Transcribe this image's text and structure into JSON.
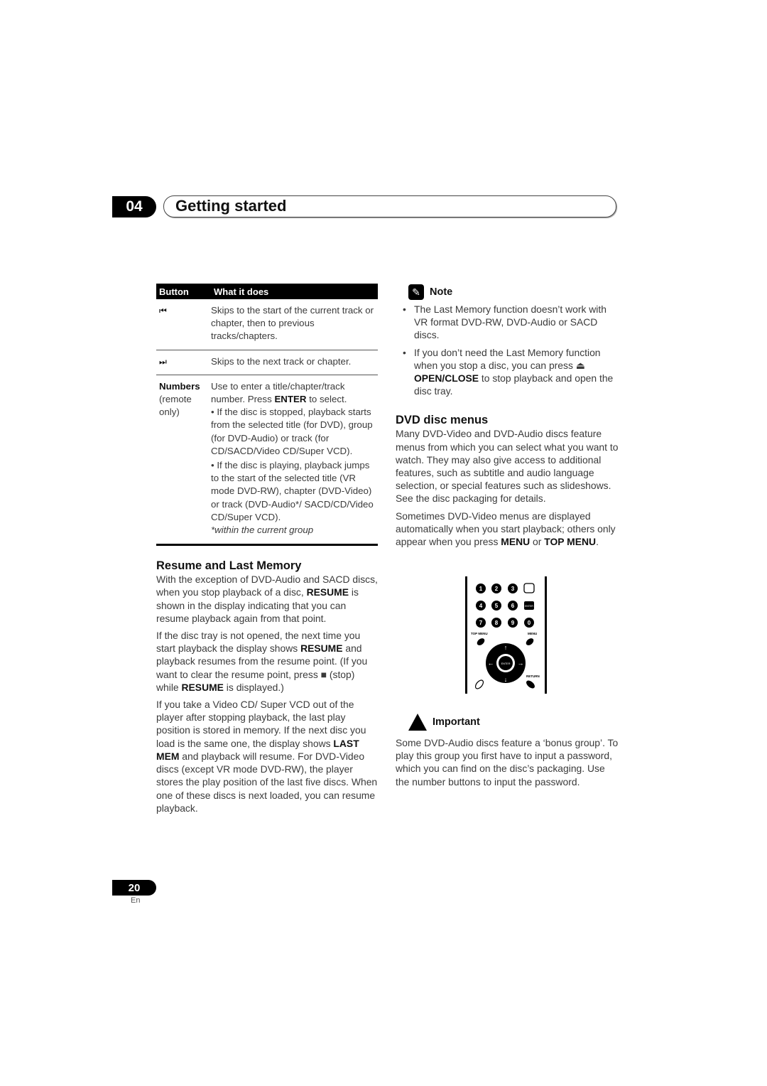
{
  "header": {
    "chapter_number": "04",
    "chapter_title": "Getting started"
  },
  "table": {
    "headers": [
      "Button",
      "What it does"
    ],
    "rows": [
      {
        "button_icon": "skip-previous-icon",
        "button_glyph": "⏮",
        "description": "Skips to the start of the current track or chapter, then to previous tracks/chapters."
      },
      {
        "button_icon": "skip-next-icon",
        "button_glyph": "⏭",
        "description": "Skips to the next track or chapter."
      },
      {
        "button_label": "Numbers",
        "button_sublabel": "(remote only)",
        "description_pre": "Use to enter a title/chapter/track number. Press ",
        "description_bold": "ENTER",
        "description_post": " to select.",
        "bullet1": "• If the disc is stopped, playback starts from the selected title (for DVD), group (for DVD-Audio) or track (for CD/SACD/Video CD/Super VCD).",
        "bullet2": "• If the disc is playing, playback jumps to the start of the selected title (VR mode DVD-RW), chapter (DVD-Video) or track (DVD-Audio*/ SACD/CD/Video CD/Super VCD).",
        "footnote": "*within the current group"
      }
    ]
  },
  "resume": {
    "heading": "Resume and Last Memory",
    "p1_a": "With the exception of DVD-Audio and SACD discs, when you stop playback of a disc, ",
    "p1_b": "RESUME",
    "p1_c": " is shown in the display indicating that you can resume playback again from that point.",
    "p2_a": "If the disc tray is not opened, the next time you start playback the display shows ",
    "p2_b": "RESUME",
    "p2_c": " and playback resumes from the resume point. (If you want to clear the resume point, press ■ (stop) while ",
    "p2_d": "RESUME",
    "p2_e": " is displayed.)",
    "p3_a": "If you take a Video CD/ Super VCD out of the player after stopping playback, the last play position is stored in memory. If the next disc you load is the same one, the display shows ",
    "p3_b": "LAST MEM",
    "p3_c": " and playback will resume. For DVD-Video discs (except VR mode DVD-RW), the player stores the play position of the last five discs. When one of these discs is next loaded, you can resume playback."
  },
  "note": {
    "label": "Note",
    "item1": "The Last Memory function doesn’t work with VR format DVD-RW, DVD-Audio or SACD discs.",
    "item2_a": "If you don’t need the Last Memory function when you stop a disc, you can press ⏏ ",
    "item2_b": "OPEN/CLOSE",
    "item2_c": " to stop playback and open the disc tray."
  },
  "dvd_menus": {
    "heading": "DVD disc menus",
    "p1": "Many DVD-Video and DVD-Audio discs feature menus from which you can select what you want to watch. They may also give access to additional features, such as subtitle and audio language selection, or special features such as slideshows. See the disc packaging for details.",
    "p2_a": "Sometimes DVD-Video menus are displayed automatically when you start playback; others only appear when you press ",
    "p2_b": "MENU",
    "p2_c": " or ",
    "p2_d": "TOP MENU",
    "p2_e": "."
  },
  "remote": {
    "number_keys": [
      "1",
      "2",
      "3",
      "4",
      "5",
      "6",
      "7",
      "8",
      "9",
      "0"
    ],
    "enter_small": "ENTER",
    "top_menu": "TOP MENU",
    "menu": "MENU",
    "enter": "ENTER",
    "return": "RETURN"
  },
  "important": {
    "label": "Important",
    "text": "Some DVD-Audio discs feature a ‘bonus group’. To play this group you first have to input a password, which you can find on the disc’s packaging. Use the number buttons to input the password."
  },
  "footer": {
    "page_number": "20",
    "language": "En"
  }
}
